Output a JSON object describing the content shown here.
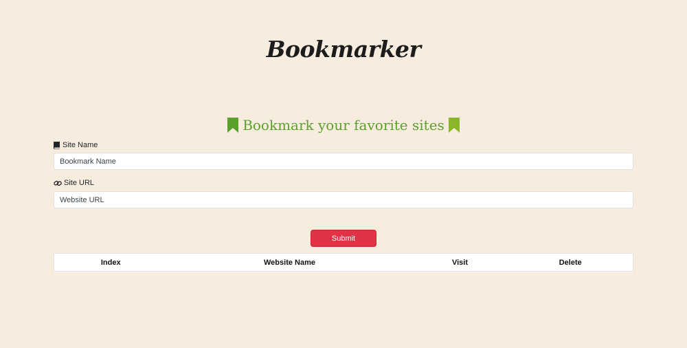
{
  "brand": {
    "logo_text": "Bookmarker",
    "underline_color": "#f7c45f"
  },
  "heading": {
    "text": "Bookmark your favorite sites",
    "color": "#5aa02c",
    "icon": "bookmark-icon"
  },
  "form": {
    "site_name": {
      "label": "Site Name",
      "icon": "book-icon",
      "placeholder": "Bookmark Name",
      "value": ""
    },
    "site_url": {
      "label": "Site URL",
      "icon": "link-icon",
      "placeholder": "Website URL",
      "value": ""
    },
    "submit_label": "Submit",
    "submit_color": "#e13345"
  },
  "table": {
    "columns": [
      "Index",
      "Website Name",
      "Visit",
      "Delete"
    ],
    "rows": []
  }
}
